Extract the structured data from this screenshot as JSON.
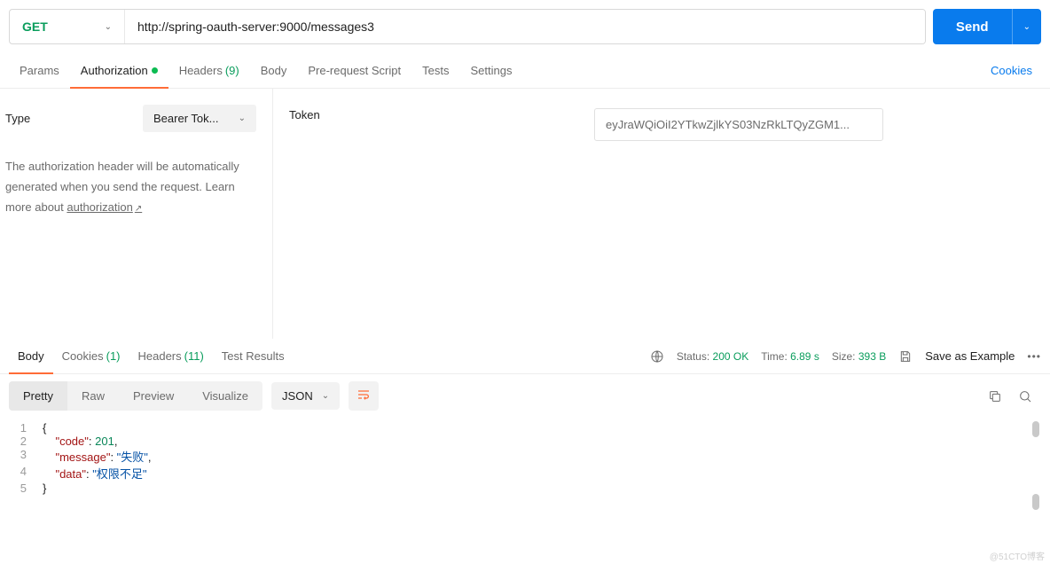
{
  "request": {
    "method": "GET",
    "url": "http://spring-oauth-server:9000/messages3",
    "send_label": "Send"
  },
  "tabs": {
    "params": "Params",
    "authorization": "Authorization",
    "headers": "Headers",
    "headers_count": "(9)",
    "body": "Body",
    "prerequest": "Pre-request Script",
    "tests": "Tests",
    "settings": "Settings",
    "cookies_link": "Cookies"
  },
  "auth": {
    "type_label": "Type",
    "type_value": "Bearer Tok...",
    "description": "The authorization header will be automatically generated when you send the request. Learn more about ",
    "learn_link": "authorization",
    "token_label": "Token",
    "token_value": "eyJraWQiOiI2YTkwZjlkYS03NzRkLTQyZGM1..."
  },
  "resp_tabs": {
    "body": "Body",
    "cookies": "Cookies",
    "cookies_count": "(1)",
    "headers": "Headers",
    "headers_count": "(11)",
    "test_results": "Test Results"
  },
  "meta": {
    "status_label": "Status:",
    "status_value": "200 OK",
    "time_label": "Time:",
    "time_value": "6.89 s",
    "size_label": "Size:",
    "size_value": "393 B",
    "save_example": "Save as Example"
  },
  "view": {
    "pretty": "Pretty",
    "raw": "Raw",
    "preview": "Preview",
    "visualize": "Visualize",
    "format": "JSON"
  },
  "response_body": {
    "code_key": "\"code\"",
    "code_val": "201",
    "message_key": "\"message\"",
    "message_val": "\"失败\"",
    "data_key": "\"data\"",
    "data_val": "\"权限不足\""
  },
  "watermark": "@51CTO博客"
}
